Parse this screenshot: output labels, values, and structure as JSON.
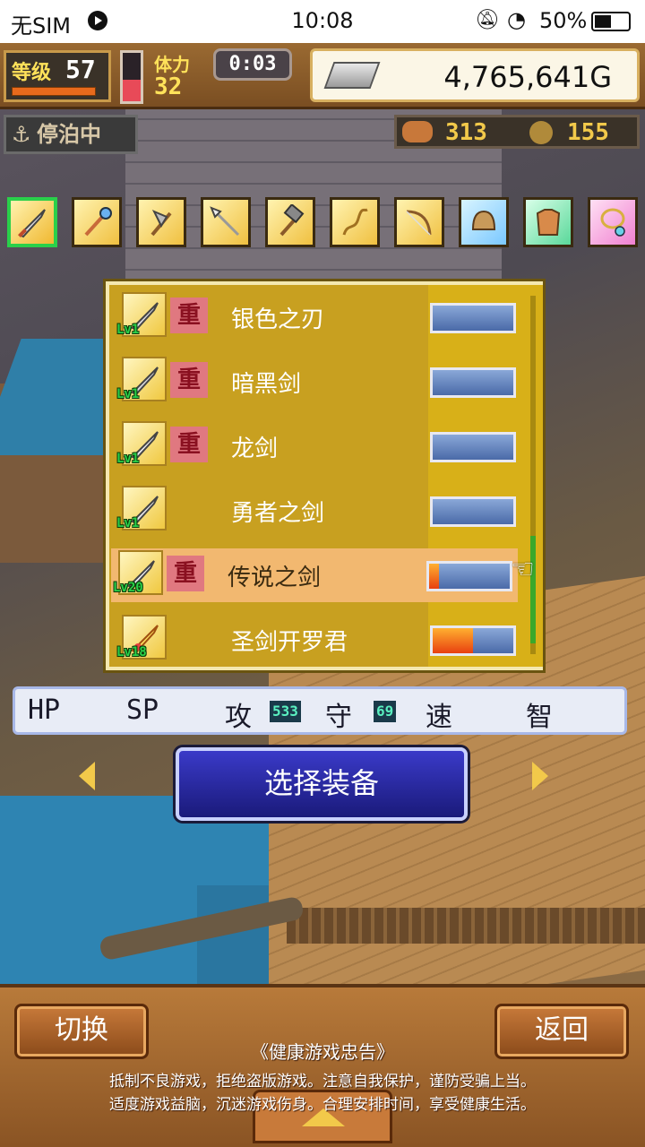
{
  "status_bar": {
    "carrier": "无SIM",
    "time": "10:08",
    "battery": "50%",
    "icons": [
      "target-icon",
      "mute-icon",
      "wifi-icon",
      "battery-icon"
    ]
  },
  "hud": {
    "level_label": "等级",
    "level": "57",
    "stamina_label": "体力",
    "stamina": "32",
    "stamina_fraction": 0.45,
    "timer": "0:03",
    "gold": "4,765,641G"
  },
  "harbor": {
    "status": "停泊中",
    "resource1": "313",
    "resource2": "155"
  },
  "categories": [
    {
      "icon": "sword-icon",
      "selected": true
    },
    {
      "icon": "staff-icon"
    },
    {
      "icon": "axe-icon"
    },
    {
      "icon": "spear-icon"
    },
    {
      "icon": "hammer-icon"
    },
    {
      "icon": "whip-icon"
    },
    {
      "icon": "bow-icon"
    },
    {
      "icon": "helmet-icon"
    },
    {
      "icon": "armor-icon"
    },
    {
      "icon": "necklace-icon"
    }
  ],
  "equipment": [
    {
      "name": "银色之刃",
      "level": "1",
      "heavy": "重",
      "gauge": 0.0
    },
    {
      "name": "暗黑剑",
      "level": "1",
      "heavy": "重",
      "gauge": 0.0
    },
    {
      "name": "龙剑",
      "level": "1",
      "heavy": "重",
      "gauge": 0.0
    },
    {
      "name": "勇者之剑",
      "level": "1",
      "heavy": "",
      "gauge": 0.0
    },
    {
      "name": "传说之剑",
      "level": "20",
      "heavy": "重",
      "gauge": 0.12,
      "selected": true
    },
    {
      "name": "圣剑开罗君",
      "level": "18",
      "heavy": "",
      "gauge": 0.5
    }
  ],
  "lv_prefix": "Lv",
  "stats": {
    "hp_label": "HP",
    "sp_label": "SP",
    "attack_label": "攻",
    "attack_value": "533",
    "defense_label": "守",
    "defense_value": "69",
    "speed_label": "速",
    "intel_label": "智"
  },
  "actions": {
    "select_equipment": "选择装备",
    "switch": "切换",
    "back": "返回"
  },
  "notice": {
    "title": "《健康游戏忠告》",
    "line1": "抵制不良游戏，拒绝盗版游戏。注意自我保护，谨防受骗上当。",
    "line2": "适度游戏益脑，沉迷游戏伤身。合理安排时间，享受健康生活。"
  },
  "colors": {
    "panel": "#c8a020",
    "selected_row": "#f2b870",
    "heavy_badge": "#e07880",
    "button_blue": "#2a2aa8"
  }
}
